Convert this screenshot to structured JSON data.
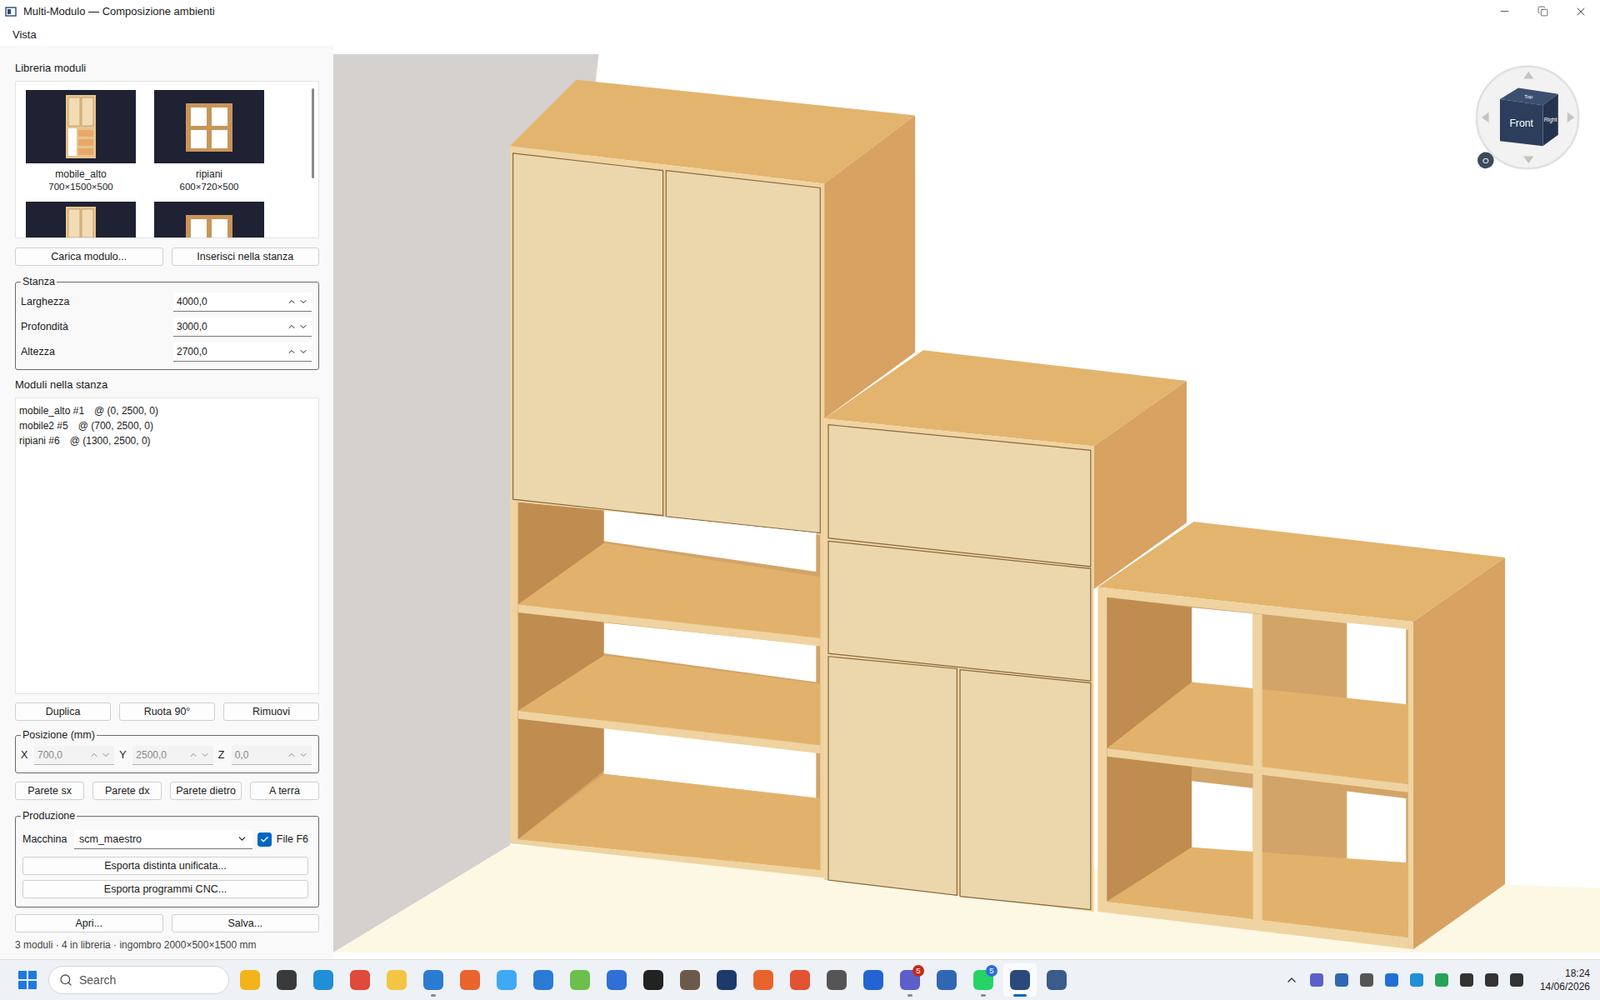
{
  "window": {
    "title": "Multi-Modulo — Composizione ambienti"
  },
  "menu": [
    "Vista"
  ],
  "library": {
    "title": "Libreria moduli",
    "items": [
      {
        "name": "mobile_alto",
        "size": "700×1500×500"
      },
      {
        "name": "ripiani",
        "size": "600×720×500"
      }
    ],
    "partial_items": 2,
    "buttons": [
      "Carica modulo...",
      "Inserisci nella stanza"
    ]
  },
  "room": {
    "title": "Stanza",
    "fields": [
      {
        "label": "Larghezza",
        "value": "4000,0"
      },
      {
        "label": "Profondità",
        "value": "3000,0"
      },
      {
        "label": "Altezza",
        "value": "2700,0"
      }
    ]
  },
  "modules": {
    "title": "Moduli nella stanza",
    "items": [
      {
        "name": "mobile_alto #1",
        "position": "@ (0, 2500, 0)"
      },
      {
        "name": "mobile2 #5",
        "position": "@ (700, 2500, 0)"
      },
      {
        "name": "ripiani #6",
        "position": "@ (1300, 2500, 0)"
      }
    ]
  },
  "module_actions": [
    "Duplica",
    "Ruota 90°",
    "Rimuovi"
  ],
  "position": {
    "title": "Posizione (mm)",
    "disabled": true,
    "fields": [
      {
        "label": "X",
        "value": "700,0"
      },
      {
        "label": "Y",
        "value": "2500,0"
      },
      {
        "label": "Z",
        "value": "0,0"
      }
    ]
  },
  "snap_buttons": [
    "Parete sx",
    "Parete dx",
    "Parete dietro",
    "A terra"
  ],
  "production": {
    "title": "Produzione",
    "machine_label": "Macchina",
    "machine": "scm_maestro",
    "f6": {
      "label": "File F6",
      "checked": true
    },
    "buttons": [
      "Esporta distinta unificata...",
      "Esporta programmi CNC..."
    ]
  },
  "file_buttons": [
    "Apri...",
    "Salva..."
  ],
  "status_bar": "3 moduli · 4 in libreria · ingombro 2000×500×1500 mm",
  "viewport": {
    "view_cube": {
      "front": "Front",
      "right": "Right",
      "top": "Top",
      "home": "O"
    }
  },
  "taskbar": {
    "search": "Search",
    "apps": [
      {
        "running": false,
        "active": false
      },
      {
        "running": false,
        "active": false
      },
      {
        "running": false,
        "active": false
      },
      {
        "running": false,
        "active": false
      },
      {
        "running": false,
        "active": false
      },
      {
        "running": true,
        "active": false
      },
      {
        "running": false,
        "active": false
      },
      {
        "running": false,
        "active": false
      },
      {
        "running": false,
        "active": false
      },
      {
        "running": false,
        "active": false
      },
      {
        "running": false,
        "active": false
      },
      {
        "running": false,
        "active": false
      },
      {
        "running": false,
        "active": false
      },
      {
        "running": false,
        "active": false
      },
      {
        "running": false,
        "active": false
      },
      {
        "running": false,
        "active": false
      },
      {
        "running": false,
        "active": false
      },
      {
        "running": false,
        "active": false
      },
      {
        "running": true,
        "active": false,
        "badge": "5",
        "badge_color": "#c42b1c"
      },
      {
        "running": false,
        "active": false
      },
      {
        "running": true,
        "active": false,
        "badge": "5",
        "badge_color": "#2f6fd6"
      },
      {
        "running": true,
        "active": true
      },
      {
        "running": false,
        "active": false
      }
    ],
    "time": "18:24",
    "date": "14/06/2026"
  }
}
